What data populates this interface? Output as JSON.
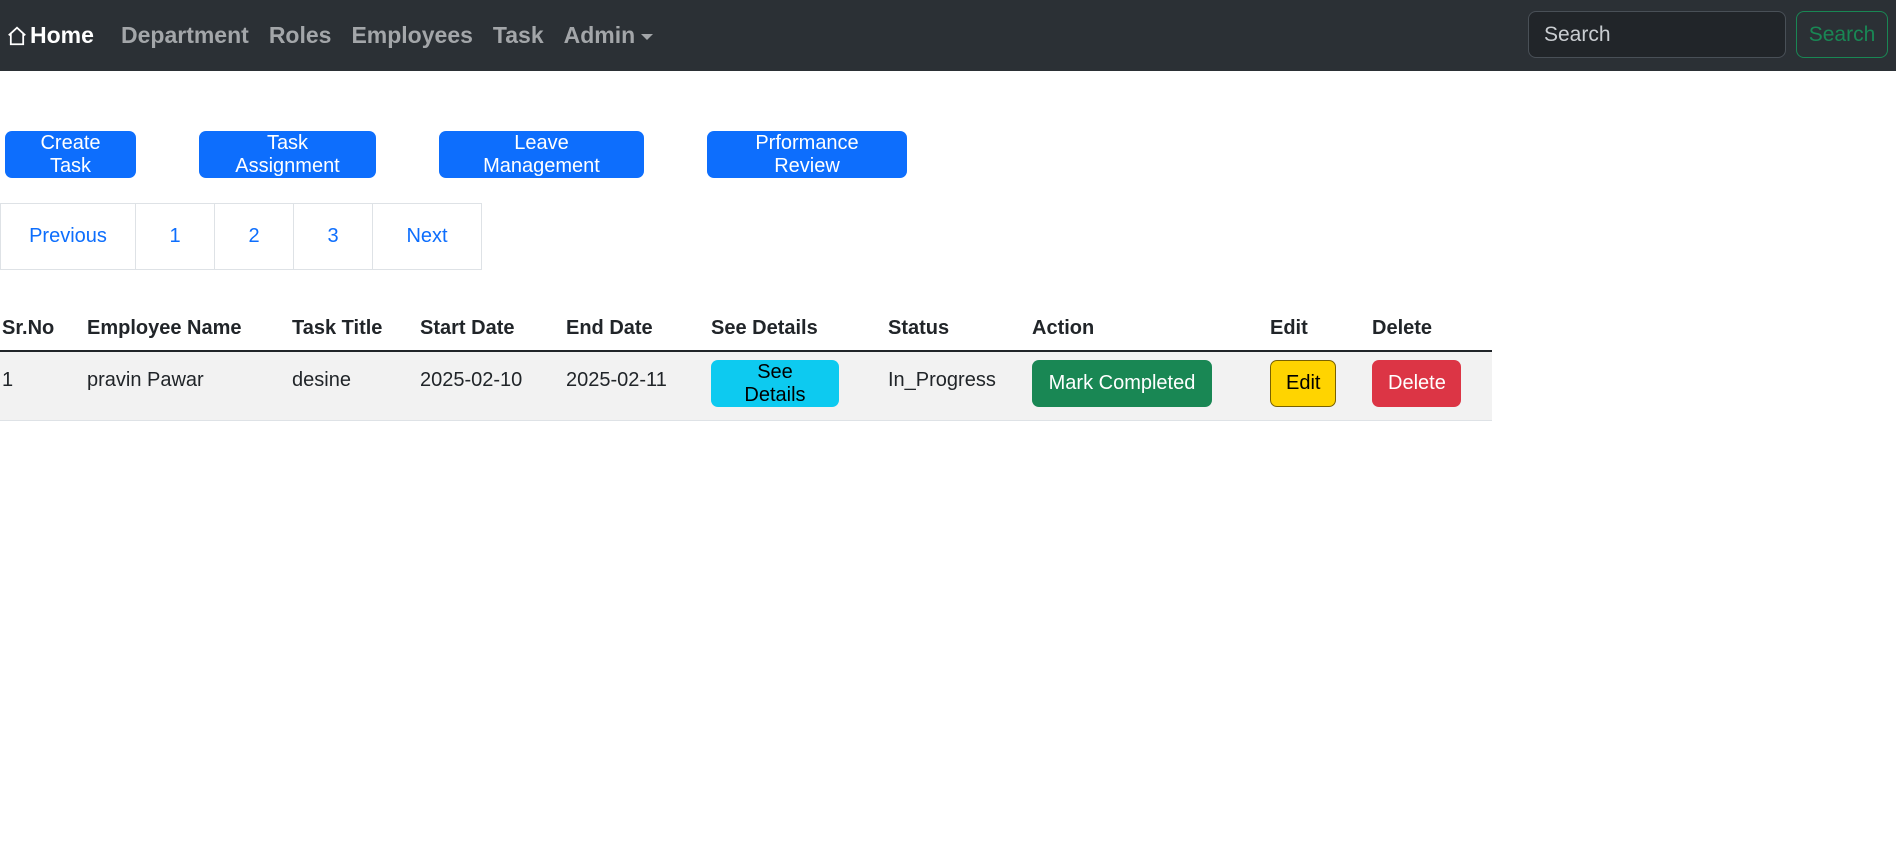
{
  "navbar": {
    "brand": "Home",
    "links": [
      "Department",
      "Roles",
      "Employees",
      "Task",
      "Admin"
    ],
    "search_placeholder": "Search",
    "search_button": "Search"
  },
  "actions": {
    "create_task": "Create Task",
    "task_assignment": "Task Assignment",
    "leave_management": "Leave Management",
    "performance_review": "Prformance Review"
  },
  "pagination": {
    "previous": "Previous",
    "pages": [
      "1",
      "2",
      "3"
    ],
    "next": "Next"
  },
  "table": {
    "headers": [
      "Sr.No",
      "Employee Name",
      "Task Title",
      "Start Date",
      "End Date",
      "See Details",
      "Status",
      "Action",
      "Edit",
      "Delete"
    ],
    "rows": [
      {
        "sr_no": "1",
        "employee_name": "pravin Pawar",
        "task_title": "desine",
        "start_date": "2025-02-10",
        "end_date": "2025-02-11",
        "see_details": "See Details",
        "status": "In_Progress",
        "action": "Mark Completed",
        "edit": "Edit",
        "delete": "Delete"
      }
    ]
  },
  "colors": {
    "navbar_bg": "#2b3035",
    "primary": "#0d6efd",
    "success": "#198754",
    "info": "#0dcaf0",
    "warning": "#ffd400",
    "danger": "#dc3545"
  }
}
